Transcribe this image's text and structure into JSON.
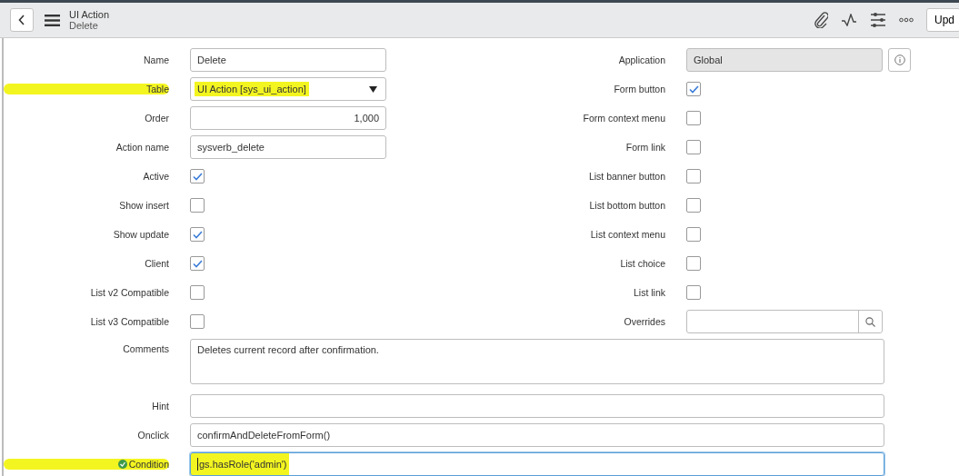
{
  "header": {
    "title": "UI Action",
    "subtitle": "Delete",
    "update_button": "Upd"
  },
  "left_fields": [
    {
      "kind": "text",
      "label": "Name",
      "value": "Delete",
      "highlighted": false
    },
    {
      "kind": "select",
      "label": "Table",
      "value": "UI Action [sys_ui_action]",
      "highlighted": true
    },
    {
      "kind": "number",
      "label": "Order",
      "value": "1,000",
      "highlighted": false
    },
    {
      "kind": "text",
      "label": "Action name",
      "value": "sysverb_delete",
      "highlighted": false
    },
    {
      "kind": "checkbox",
      "label": "Active",
      "checked": true
    },
    {
      "kind": "checkbox",
      "label": "Show insert",
      "checked": false
    },
    {
      "kind": "checkbox",
      "label": "Show update",
      "checked": true
    },
    {
      "kind": "checkbox",
      "label": "Client",
      "checked": true
    },
    {
      "kind": "checkbox",
      "label": "List v2 Compatible",
      "checked": false
    },
    {
      "kind": "checkbox",
      "label": "List v3 Compatible",
      "checked": false
    }
  ],
  "right_fields": [
    {
      "kind": "readonly",
      "label": "Application",
      "value": "Global"
    },
    {
      "kind": "checkbox",
      "label": "Form button",
      "checked": true
    },
    {
      "kind": "checkbox",
      "label": "Form context menu",
      "checked": false
    },
    {
      "kind": "checkbox",
      "label": "Form link",
      "checked": false
    },
    {
      "kind": "checkbox",
      "label": "List banner button",
      "checked": false
    },
    {
      "kind": "checkbox",
      "label": "List bottom button",
      "checked": false
    },
    {
      "kind": "checkbox",
      "label": "List context menu",
      "checked": false
    },
    {
      "kind": "checkbox",
      "label": "List choice",
      "checked": false
    },
    {
      "kind": "checkbox",
      "label": "List link",
      "checked": false
    },
    {
      "kind": "reference",
      "label": "Overrides"
    }
  ],
  "wide_fields": [
    {
      "kind": "textarea",
      "label": "Comments",
      "value": "Deletes current record after confirmation."
    },
    {
      "kind": "text",
      "label": "Hint"
    },
    {
      "kind": "text",
      "label": "Onclick",
      "value": "confirmAndDeleteFromForm()"
    },
    {
      "kind": "text",
      "label": "Condition",
      "value": "gs.hasRole('admin')",
      "highlighted": true,
      "focused": true,
      "valid_icon": true
    }
  ]
}
